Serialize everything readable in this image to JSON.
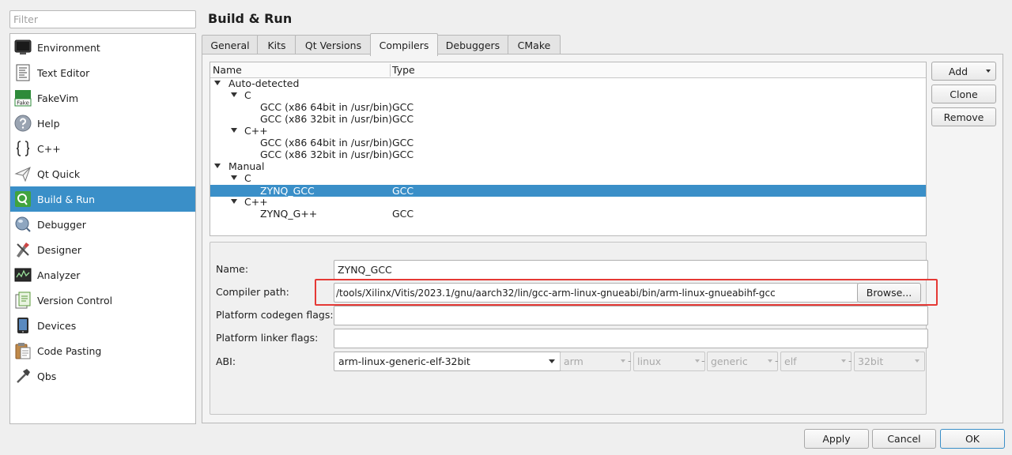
{
  "filter": {
    "placeholder": "Filter"
  },
  "sidebar": {
    "items": [
      {
        "label": "Environment",
        "icon": "monitor-icon"
      },
      {
        "label": "Text Editor",
        "icon": "text-document-icon"
      },
      {
        "label": "FakeVim",
        "icon": "fakevim-icon",
        "icon_text": "Fake"
      },
      {
        "label": "Help",
        "icon": "help-icon"
      },
      {
        "label": "C++",
        "icon": "braces-icon"
      },
      {
        "label": "Qt Quick",
        "icon": "paper-plane-icon"
      },
      {
        "label": "Build & Run",
        "icon": "build-run-icon",
        "selected": true
      },
      {
        "label": "Debugger",
        "icon": "debugger-icon"
      },
      {
        "label": "Designer",
        "icon": "designer-icon"
      },
      {
        "label": "Analyzer",
        "icon": "analyzer-icon"
      },
      {
        "label": "Version Control",
        "icon": "version-control-icon"
      },
      {
        "label": "Devices",
        "icon": "device-icon"
      },
      {
        "label": "Code Pasting",
        "icon": "clipboard-icon"
      },
      {
        "label": "Qbs",
        "icon": "hammer-icon"
      }
    ]
  },
  "page": {
    "title": "Build & Run"
  },
  "tabs": [
    {
      "label": "General"
    },
    {
      "label": "Kits"
    },
    {
      "label": "Qt Versions"
    },
    {
      "label": "Compilers",
      "active": true
    },
    {
      "label": "Debuggers"
    },
    {
      "label": "CMake"
    }
  ],
  "tree": {
    "columns": {
      "name": "Name",
      "type": "Type"
    },
    "rows": [
      {
        "name": "Auto-detected",
        "type": "",
        "depth": 0,
        "expanded": true
      },
      {
        "name": "C",
        "type": "",
        "depth": 1,
        "expanded": true
      },
      {
        "name": "GCC (x86 64bit in /usr/bin)",
        "type": "GCC",
        "depth": 2
      },
      {
        "name": "GCC (x86 32bit in /usr/bin)",
        "type": "GCC",
        "depth": 2
      },
      {
        "name": "C++",
        "type": "",
        "depth": 1,
        "expanded": true
      },
      {
        "name": "GCC (x86 64bit in /usr/bin)",
        "type": "GCC",
        "depth": 2
      },
      {
        "name": "GCC (x86 32bit in /usr/bin)",
        "type": "GCC",
        "depth": 2
      },
      {
        "name": "Manual",
        "type": "",
        "depth": 0,
        "expanded": true
      },
      {
        "name": "C",
        "type": "",
        "depth": 1,
        "expanded": true
      },
      {
        "name": "ZYNQ_GCC",
        "type": "GCC",
        "depth": 2,
        "selected": true
      },
      {
        "name": "C++",
        "type": "",
        "depth": 1,
        "expanded": true
      },
      {
        "name": "ZYNQ_G++",
        "type": "GCC",
        "depth": 2
      }
    ]
  },
  "buttons": {
    "add": "Add",
    "clone": "Clone",
    "remove": "Remove",
    "browse": "Browse...",
    "apply": "Apply",
    "cancel": "Cancel",
    "ok": "OK"
  },
  "details": {
    "name_label": "Name:",
    "name_value": "ZYNQ_GCC",
    "compiler_path_label": "Compiler path:",
    "compiler_path_value": "/tools/Xilinx/Vitis/2023.1/gnu/aarch32/lin/gcc-arm-linux-gnueabi/bin/arm-linux-gnueabihf-gcc",
    "codegen_label": "Platform codegen flags:",
    "codegen_value": "",
    "linker_label": "Platform linker flags:",
    "linker_value": "",
    "abi_label": "ABI:",
    "abi_value": "arm-linux-generic-elf-32bit",
    "abi_arch": "arm",
    "abi_os": "linux",
    "abi_flavor": "generic",
    "abi_format": "elf",
    "abi_width": "32bit",
    "abi_separator": "-"
  },
  "colors": {
    "selection": "#3a8fc8",
    "highlight": "#e53935"
  }
}
